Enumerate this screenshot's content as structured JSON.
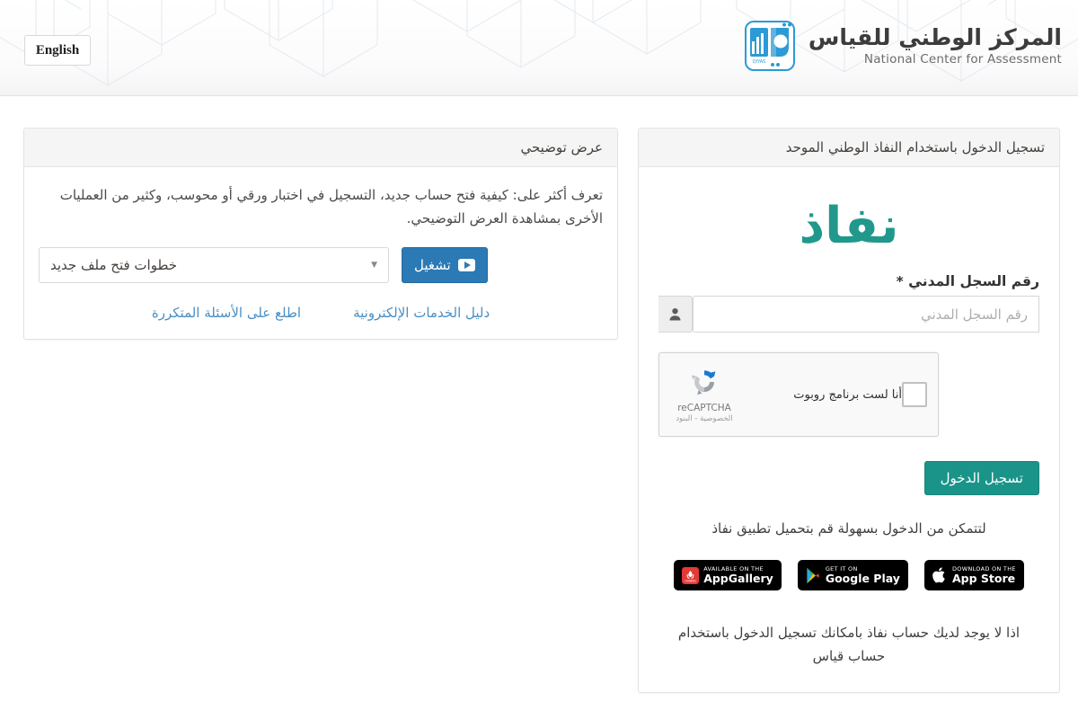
{
  "header": {
    "lang_button": "English",
    "brand_ar": "المركز الوطني للقياس",
    "brand_en": "National Center for Assessment",
    "logo_caption": "QIYAS"
  },
  "login": {
    "panel_title": "تسجيل الدخول باستخدام النفاذ الوطني الموحد",
    "nafath_logo_text": "نفاذ",
    "id_label": "رقم السجل المدني *",
    "id_placeholder": "رقم السجل المدني",
    "id_value": "",
    "recaptcha": {
      "checkbox_label": "أنا لست برنامج روبوت",
      "brand": "reCAPTCHA",
      "legal": "الخصوصية - البنود"
    },
    "submit_label": "تسجيل الدخول",
    "app_note": "لتتمكن من الدخول بسهولة قم بتحميل تطبيق نفاذ",
    "badges": [
      {
        "small": "Available on the",
        "big": "AppGallery"
      },
      {
        "small": "Get it on",
        "big": "Google Play"
      },
      {
        "small": "Download on the",
        "big": "App Store"
      }
    ],
    "no_account_text": "اذا لا يوجد لديك حساب نفاذ بامكانك تسجيل الدخول باستخدام حساب قياس"
  },
  "demo": {
    "panel_title": "عرض توضيحي",
    "description": "تعرف أكثر على: كيفية فتح حساب جديد، التسجيل في اختبار ورقي أو محوسب، وكثير من العمليات الأخرى بمشاهدة العرض التوضيحي.",
    "select_value": "خطوات فتح ملف جديد",
    "play_label": "تشغيل",
    "links": [
      "اطلع على الأسئلة المتكررة",
      "دليل الخدمات الإلكترونية"
    ]
  },
  "colors": {
    "nafath_teal": "#21988c",
    "login_button": "#1a9488",
    "play_button": "#2b7ab5",
    "link_blue": "#4a8fc4",
    "logo_blue": "#2b9ad6"
  }
}
